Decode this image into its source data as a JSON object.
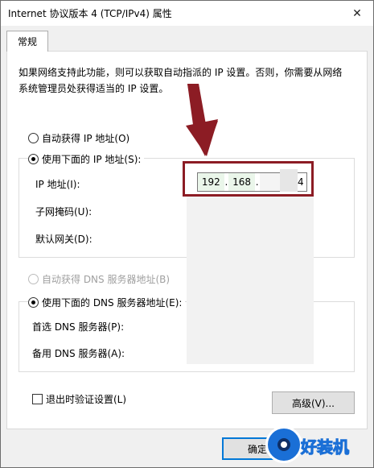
{
  "window": {
    "title": "Internet 协议版本 4 (TCP/IPv4) 属性",
    "close_glyph": "✕"
  },
  "tab": {
    "label": "常规"
  },
  "description": "如果网络支持此功能，则可以获取自动指派的 IP 设置。否则，你需要从网络系统管理员处获得适当的 IP 设置。",
  "ip_section": {
    "auto_option": "自动获得 IP 地址(O)",
    "manual_option": "使用下面的 IP 地址(S):",
    "selected": "manual",
    "ip_label": "IP 地址(I):",
    "ip_octets": [
      "192",
      "168",
      "",
      "4"
    ],
    "ip_dot": ".",
    "mask_label": "子网掩码(U):",
    "gateway_label": "默认网关(D):"
  },
  "dns_section": {
    "auto_option": "自动获得 DNS 服务器地址(B)",
    "manual_option": "使用下面的 DNS 服务器地址(E):",
    "selected": "manual",
    "preferred_label": "首选 DNS 服务器(P):",
    "alternate_label": "备用 DNS 服务器(A):"
  },
  "validate": {
    "label": "退出时验证设置(L)",
    "checked": false
  },
  "buttons": {
    "advanced": "高级(V)...",
    "ok": "确定"
  },
  "watermark": {
    "text": "好装机"
  },
  "colors": {
    "highlight": "#8c1c24",
    "focus": "#0078d7"
  }
}
